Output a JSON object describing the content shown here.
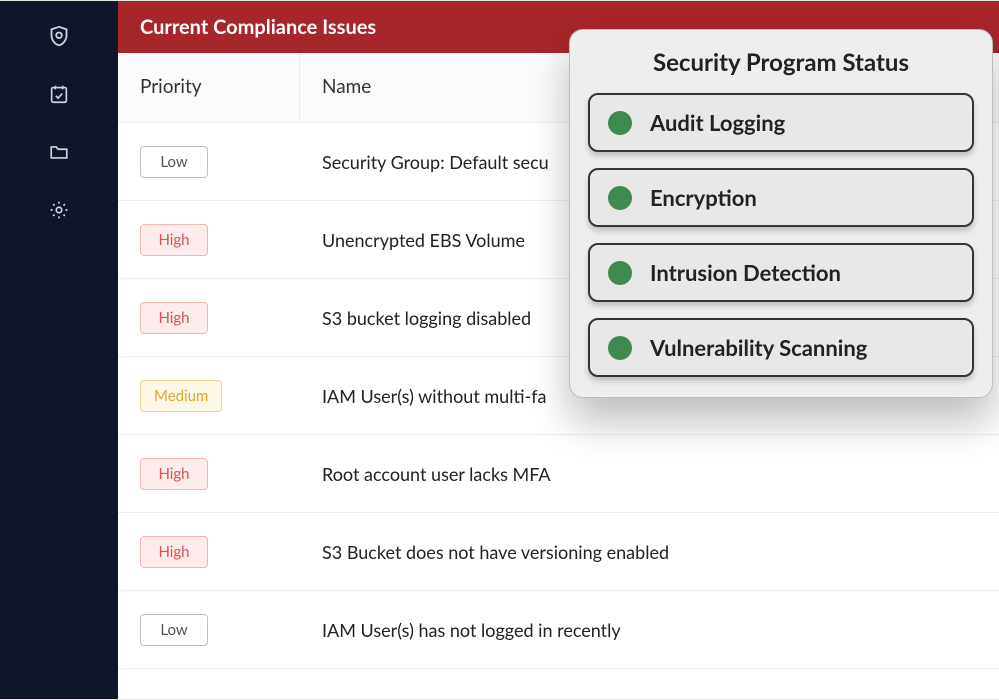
{
  "header": {
    "title": "Current Compliance Issues"
  },
  "table": {
    "columns": {
      "priority": "Priority",
      "name": "Name"
    },
    "rows": [
      {
        "priority": "Low",
        "priorityClass": "p-low",
        "name": "Security Group: Default secu"
      },
      {
        "priority": "High",
        "priorityClass": "p-high",
        "name": "Unencrypted EBS Volume"
      },
      {
        "priority": "High",
        "priorityClass": "p-high",
        "name": "S3 bucket logging disabled"
      },
      {
        "priority": "Medium",
        "priorityClass": "p-medium",
        "name": "IAM User(s) without multi-fa"
      },
      {
        "priority": "High",
        "priorityClass": "p-high",
        "name": "Root account user lacks MFA"
      },
      {
        "priority": "High",
        "priorityClass": "p-high",
        "name": "S3 Bucket does not have versioning enabled"
      },
      {
        "priority": "Low",
        "priorityClass": "p-low",
        "name": "IAM User(s) has not logged in recently"
      }
    ]
  },
  "statusCard": {
    "title": "Security Program Status",
    "items": [
      {
        "label": "Audit Logging",
        "statusColor": "#3f8a4e"
      },
      {
        "label": "Encryption",
        "statusColor": "#3f8a4e"
      },
      {
        "label": "Intrusion Detection",
        "statusColor": "#3f8a4e"
      },
      {
        "label": "Vulnerability Scanning",
        "statusColor": "#3f8a4e"
      }
    ]
  },
  "sidebar": {
    "items": [
      {
        "icon": "shield"
      },
      {
        "icon": "calendar-check"
      },
      {
        "icon": "folder"
      },
      {
        "icon": "gear"
      }
    ]
  }
}
